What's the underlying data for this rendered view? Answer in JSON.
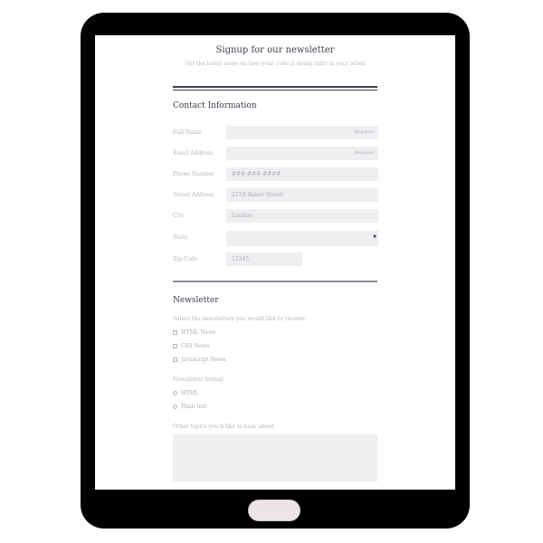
{
  "form": {
    "title": "Signup for our newsletter",
    "subtitle": "Get the latest news on how your code is doing right in your inbox",
    "contact_section": {
      "title": "Contact Information",
      "fields": [
        {
          "label": "Full Name",
          "value": "",
          "placeholder": "",
          "note": "Required"
        },
        {
          "label": "Email Address",
          "value": "",
          "placeholder": "",
          "note": "Required"
        },
        {
          "label": "Phone Number",
          "value": "",
          "placeholder": "###-###-####",
          "note": ""
        },
        {
          "label": "Street Address",
          "value": "",
          "placeholder": "221B Baker Street",
          "note": ""
        },
        {
          "label": "City",
          "value": "",
          "placeholder": "London",
          "note": ""
        },
        {
          "label": "State",
          "value": "",
          "placeholder": "",
          "note": ""
        },
        {
          "label": "Zip Code",
          "value": "",
          "placeholder": "12345",
          "note": ""
        }
      ]
    },
    "newsletter_section": {
      "title": "Newsletter",
      "select_prompt": "Select the newsletters you would like to receive",
      "newsletters": [
        {
          "label": "HTML News",
          "checked": false
        },
        {
          "label": "CSS News",
          "checked": false
        },
        {
          "label": "Javascript News",
          "checked": false
        }
      ],
      "format_prompt": "Newsletter format",
      "formats": [
        {
          "label": "HTML",
          "selected": false
        },
        {
          "label": "Plain text",
          "selected": false
        }
      ],
      "topics_prompt": "Other topics you'd like to hear about"
    }
  },
  "colors": {
    "device_frame": "#000000",
    "home_button": "#ece4e8",
    "input_bg": "#eeeff1",
    "heading_text": "#3d4150",
    "muted_text": "#b3b6be"
  }
}
